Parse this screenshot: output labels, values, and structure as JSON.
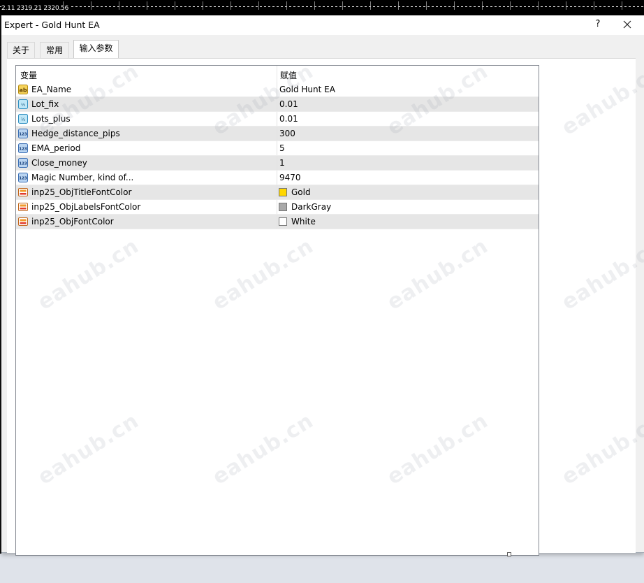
{
  "chart": {
    "price_labels": "2.11 2319.21 2320.56"
  },
  "window": {
    "title": "Expert - Gold Hunt EA",
    "help_label": "?",
    "close_icon": "close-icon"
  },
  "tabs": [
    {
      "label": "关于",
      "active": false
    },
    {
      "label": "常用",
      "active": false
    },
    {
      "label": "输入参数",
      "active": true
    }
  ],
  "table": {
    "columns": [
      "变量",
      "赋值"
    ],
    "rows": [
      {
        "icon": "string-type-icon",
        "name": "EA_Name",
        "value": "Gold Hunt EA"
      },
      {
        "icon": "double-type-icon",
        "name": "Lot_fix",
        "value": "0.01"
      },
      {
        "icon": "double-type-icon",
        "name": "Lots_plus",
        "value": "0.01"
      },
      {
        "icon": "integer-type-icon",
        "name": "Hedge_distance_pips",
        "value": "300"
      },
      {
        "icon": "integer-type-icon",
        "name": "EMA_period",
        "value": "5"
      },
      {
        "icon": "integer-type-icon",
        "name": "Close_money",
        "value": "1"
      },
      {
        "icon": "integer-type-icon",
        "name": "Magic Number, kind of...",
        "value": "9470"
      },
      {
        "icon": "color-type-icon",
        "name": "inp25_ObjTitleFontColor",
        "value": "Gold",
        "swatch": "#FFD700"
      },
      {
        "icon": "color-type-icon",
        "name": "inp25_ObjLabelsFontColor",
        "value": "DarkGray",
        "swatch": "#A9A9A9"
      },
      {
        "icon": "color-type-icon",
        "name": "inp25_ObjFontColor",
        "value": "White",
        "swatch": "#FFFFFF"
      }
    ]
  },
  "watermark": {
    "text": "eahub.cn"
  }
}
